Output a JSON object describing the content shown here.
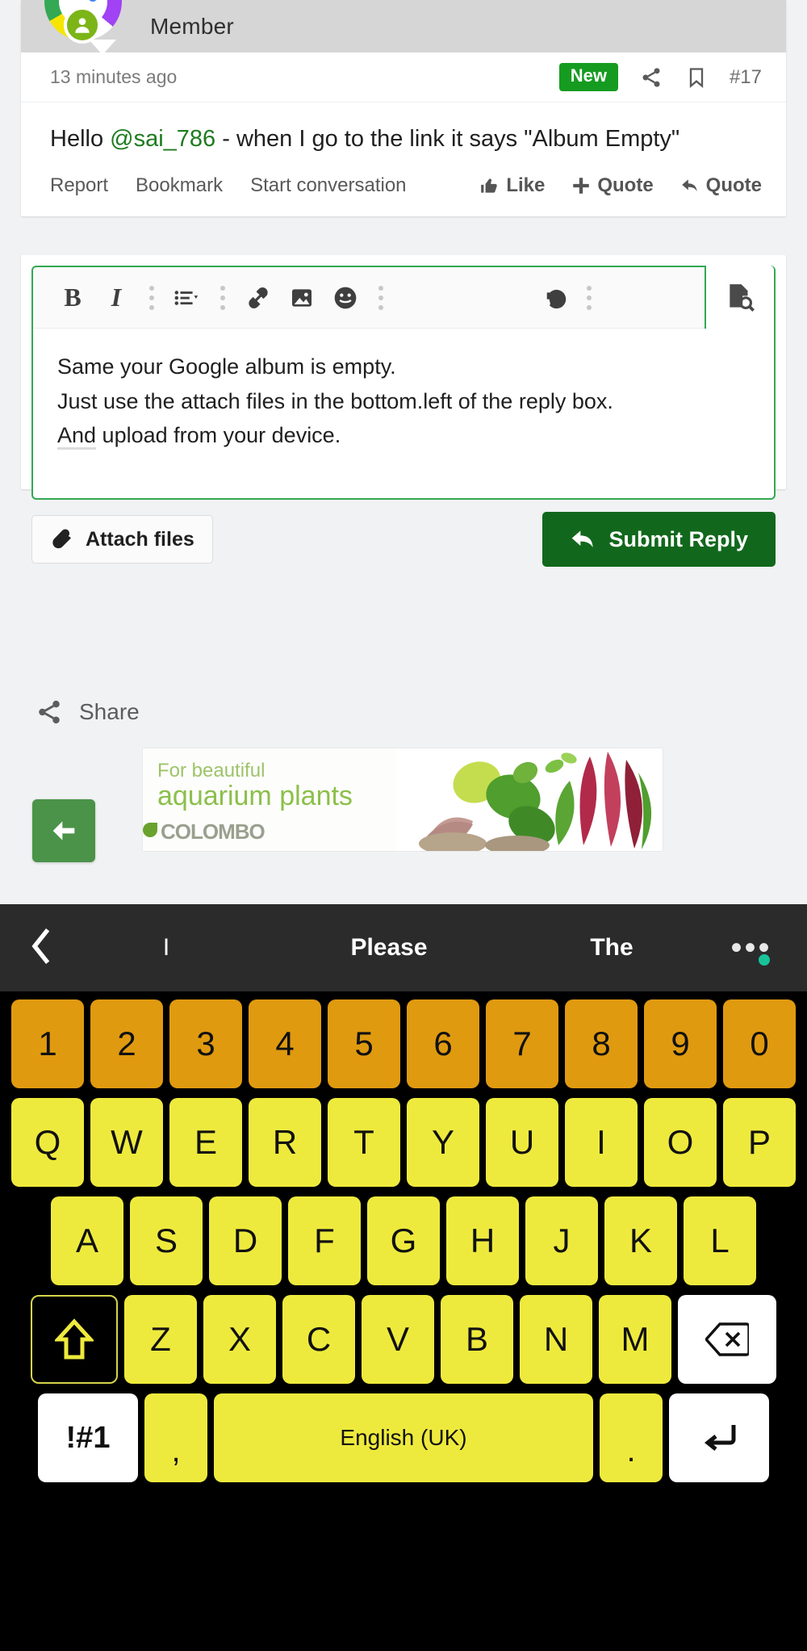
{
  "post": {
    "role_label": "Member",
    "timestamp": "13 minutes ago",
    "new_badge": "New",
    "post_number": "#17",
    "body_prefix": "Hello ",
    "mention": "@sai_786",
    "body_suffix": " - when I go to the link it says \"Album Empty\"",
    "actions_left": [
      "Report",
      "Bookmark",
      "Start conversation"
    ],
    "like_label": "Like",
    "add_quote_label": "Quote",
    "reply_quote_label": "Quote"
  },
  "editor": {
    "toolbar": {
      "bold": "B",
      "italic": "I"
    },
    "lines": [
      "Same your Google album is empty.",
      "Just use the attach files in the bottom.left of the reply box.",
      "And upload from your device."
    ],
    "line3_spell_word": "And",
    "line3_rest": " upload from your device.",
    "attach_label": "Attach files",
    "submit_label": "Submit Reply",
    "border_color": "#32a852",
    "submit_color": "#11681c"
  },
  "share": {
    "label": "Share"
  },
  "ad": {
    "line1": "For beautiful",
    "line2": "aquarium plants",
    "brand": "COLOMBO"
  },
  "keyboard": {
    "suggestions": [
      "I",
      "Please",
      "The"
    ],
    "numbers": [
      "1",
      "2",
      "3",
      "4",
      "5",
      "6",
      "7",
      "8",
      "9",
      "0"
    ],
    "row_top": [
      "Q",
      "W",
      "E",
      "R",
      "T",
      "Y",
      "U",
      "I",
      "O",
      "P"
    ],
    "row_home": [
      "A",
      "S",
      "D",
      "F",
      "G",
      "H",
      "J",
      "K",
      "L"
    ],
    "row_bottom": [
      "Z",
      "X",
      "C",
      "V",
      "B",
      "N",
      "M"
    ],
    "symbols_key": "!#1",
    "comma_key": ",",
    "space_key": "English (UK)",
    "period_key": ".",
    "num_color": "#e09a10",
    "letter_color": "#eeea3d"
  }
}
